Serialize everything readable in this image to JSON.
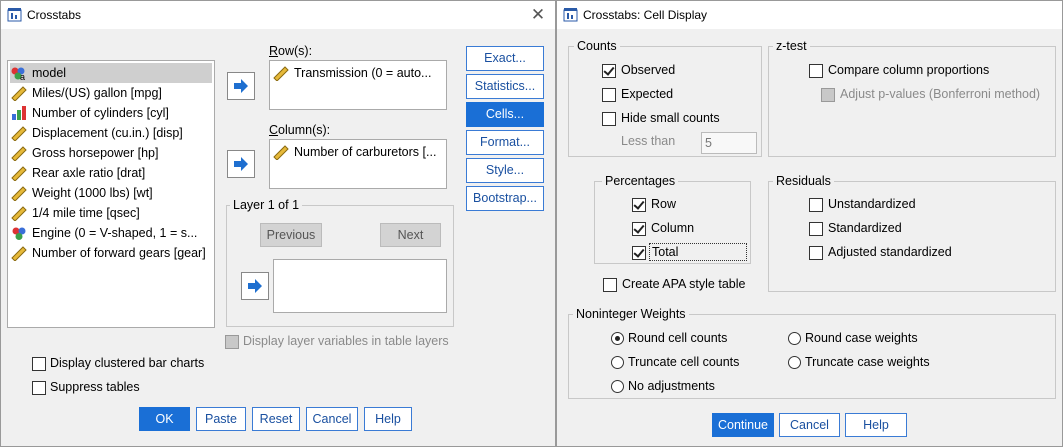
{
  "crosstabs": {
    "title": "Crosstabs",
    "variables": [
      {
        "label": "model",
        "icon": "nominal-string-icon"
      },
      {
        "label": "Miles/(US) gallon [mpg]",
        "icon": "scale-ruler-icon"
      },
      {
        "label": "Number of cylinders [cyl]",
        "icon": "ordinal-bar-icon"
      },
      {
        "label": "Displacement (cu.in.) [disp]",
        "icon": "scale-ruler-icon"
      },
      {
        "label": "Gross horsepower [hp]",
        "icon": "scale-ruler-icon"
      },
      {
        "label": "Rear axle ratio [drat]",
        "icon": "scale-ruler-icon"
      },
      {
        "label": "Weight (1000 lbs) [wt]",
        "icon": "scale-ruler-icon"
      },
      {
        "label": "1/4 mile time [qsec]",
        "icon": "scale-ruler-icon"
      },
      {
        "label": "Engine (0 = V-shaped, 1 = s...",
        "icon": "nominal-balls-icon"
      },
      {
        "label": "Number of forward gears [gear]",
        "icon": "scale-ruler-icon"
      }
    ],
    "rows_label": "Row(s):",
    "rows_value": "Transmission (0 = auto...",
    "columns_label": "Column(s):",
    "columns_value": "Number of carburetors [...",
    "layer_label": "Layer 1 of 1",
    "previous": "Previous",
    "next": "Next",
    "display_layer": "Display layer variables in table layers",
    "display_clustered": "Display clustered bar charts",
    "suppress": "Suppress tables",
    "side_buttons": {
      "exact": "Exact...",
      "statistics": "Statistics...",
      "cells": "Cells...",
      "format": "Format...",
      "style": "Style...",
      "bootstrap": "Bootstrap..."
    },
    "footer": {
      "ok": "OK",
      "paste": "Paste",
      "reset": "Reset",
      "cancel": "Cancel",
      "help": "Help"
    }
  },
  "cell_display": {
    "title": "Crosstabs: Cell Display",
    "counts": {
      "label": "Counts",
      "observed": "Observed",
      "observed_checked": true,
      "expected": "Expected",
      "expected_checked": false,
      "hide_small": "Hide small counts",
      "hide_small_checked": false,
      "less_than": "Less than",
      "less_than_value": "5"
    },
    "ztest": {
      "label": "z-test",
      "compare": "Compare column proportions",
      "compare_checked": false,
      "adjust": "Adjust p-values (Bonferroni method)"
    },
    "percentages": {
      "label": "Percentages",
      "row": "Row",
      "row_checked": true,
      "column": "Column",
      "column_checked": true,
      "total": "Total",
      "total_checked": true
    },
    "residuals": {
      "label": "Residuals",
      "unstandardized": "Unstandardized",
      "standardized": "Standardized",
      "adjusted": "Adjusted standardized"
    },
    "apa": "Create APA style table",
    "noninteger": {
      "label": "Noninteger Weights",
      "round_cell": "Round cell counts",
      "round_case": "Round case weights",
      "truncate_cell": "Truncate cell counts",
      "truncate_case": "Truncate case weights",
      "no_adjust": "No adjustments",
      "selected": "Round cell counts"
    },
    "footer": {
      "continue": "Continue",
      "cancel": "Cancel",
      "help": "Help"
    }
  }
}
